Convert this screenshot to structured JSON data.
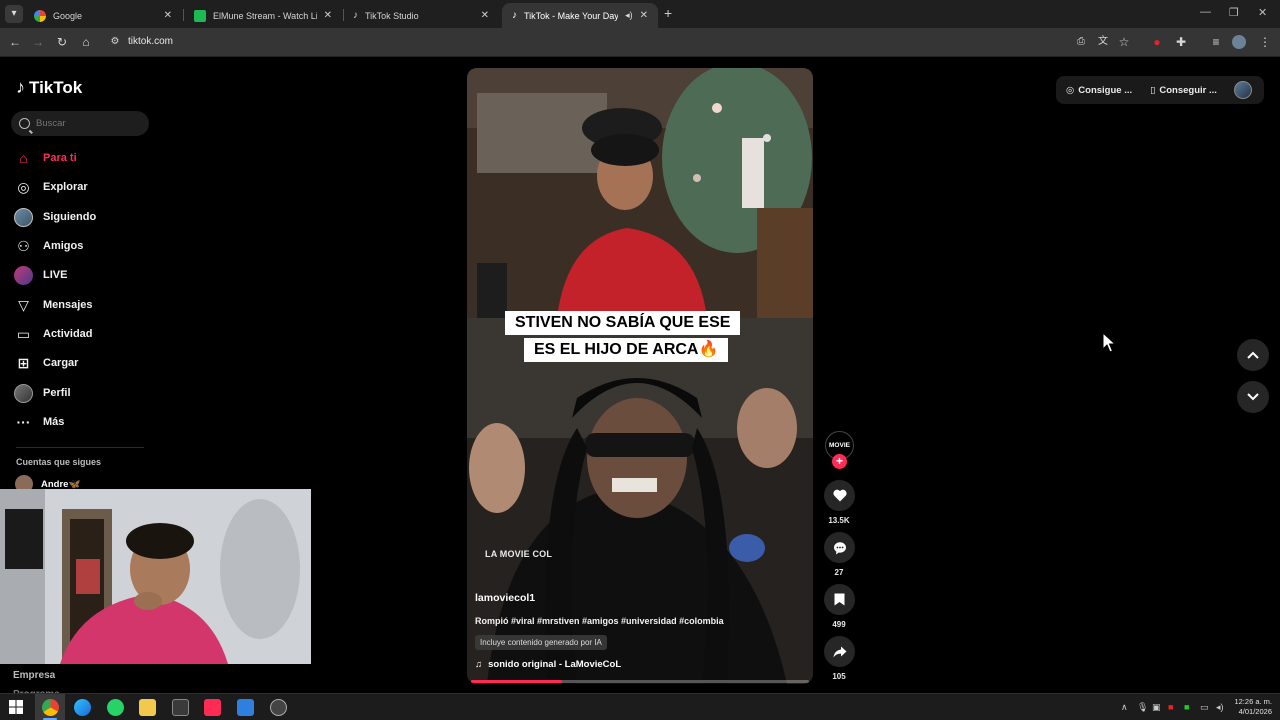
{
  "browser": {
    "tabs": [
      {
        "title": "Google",
        "active": false
      },
      {
        "title": "ElMune Stream - Watch Live on",
        "active": false
      },
      {
        "title": "TikTok Studio",
        "active": false
      },
      {
        "title": "TikTok - Make Your Day",
        "active": true
      }
    ],
    "url": "tiktok.com"
  },
  "sidebar": {
    "logo": "TikTok",
    "search_placeholder": "Buscar",
    "nav": [
      {
        "label": "Para ti",
        "icon": "home-icon",
        "active": true
      },
      {
        "label": "Explorar",
        "icon": "compass-icon"
      },
      {
        "label": "Siguiendo",
        "icon": "following-avatar-icon"
      },
      {
        "label": "Amigos",
        "icon": "friends-icon"
      },
      {
        "label": "LIVE",
        "icon": "live-icon"
      },
      {
        "label": "Mensajes",
        "icon": "messages-icon"
      },
      {
        "label": "Actividad",
        "icon": "activity-icon"
      },
      {
        "label": "Cargar",
        "icon": "upload-icon"
      },
      {
        "label": "Perfil",
        "icon": "profile-icon"
      },
      {
        "label": "Más",
        "icon": "more-icon"
      }
    ],
    "following_title": "Cuentas que sigues",
    "following": [
      {
        "name": "Andre🦋"
      }
    ],
    "footer": [
      "Empresa",
      "Programa"
    ]
  },
  "video": {
    "caption_line1": "STIVEN NO SABÍA QUE ESE",
    "caption_line2": "ES EL HIJO DE ARCA🔥",
    "watermark": "LA MOVIE COL",
    "username": "lamoviecol1",
    "description": "Rompió #viral #mrstiven #amigos #universidad #colombia",
    "ai_label": "Incluye contenido generado por IA",
    "sound": "sonido original - LaMovieCoL",
    "progress": 0.27
  },
  "actions": {
    "creator_label": "MOVIE",
    "likes": "13.5K",
    "comments": "27",
    "saves": "499",
    "shares": "105"
  },
  "topbar": {
    "get_coins": "Consigue ...",
    "get_app": "Conseguir ..."
  },
  "taskbar": {
    "time": "12:26 a. m.",
    "date": "4/01/2026"
  },
  "colors": {
    "accent": "#fe2c55",
    "background": "#000000"
  }
}
